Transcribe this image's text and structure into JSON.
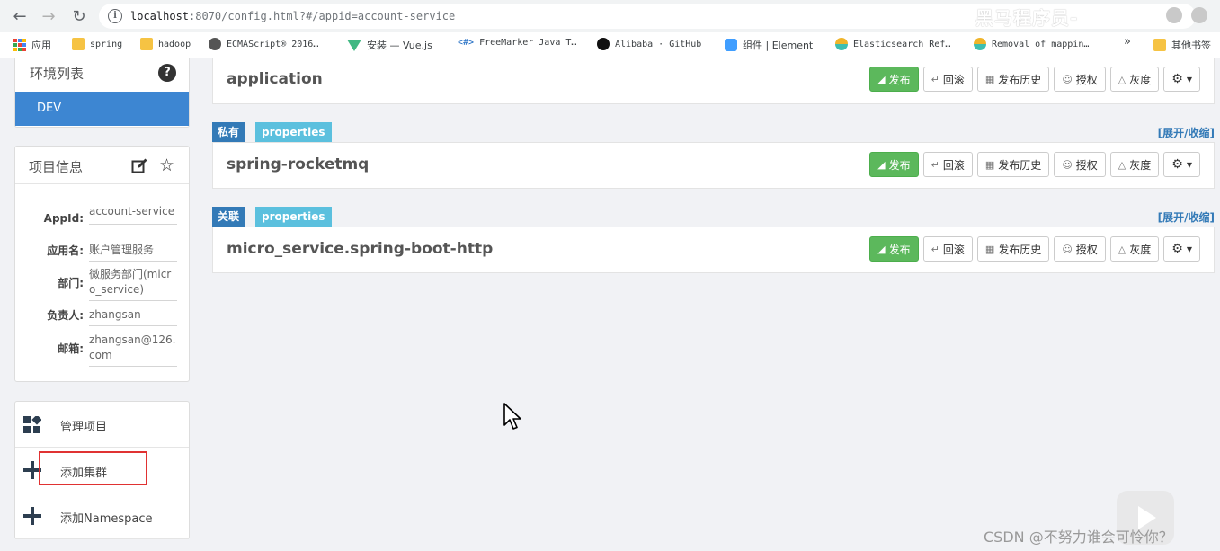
{
  "browser": {
    "url_host": "localhost",
    "url_rest": ":8070/config.html?#/appid=account-service",
    "watermark": "黑马程序员-",
    "bookmarks": [
      {
        "label": "应用",
        "icon": "apps-grid-icon"
      },
      {
        "label": "spring",
        "icon": "folder-icon"
      },
      {
        "label": "hadoop",
        "icon": "folder-icon"
      },
      {
        "label": "ECMAScript® 2016…",
        "icon": "globe-icon"
      },
      {
        "label": "安装 — Vue.js",
        "icon": "vue-icon"
      },
      {
        "label": "FreeMarker Java T…",
        "icon": "code-icon"
      },
      {
        "label": "Alibaba · GitHub",
        "icon": "github-icon"
      },
      {
        "label": "组件 | Element",
        "icon": "element-icon"
      },
      {
        "label": "Elasticsearch Ref…",
        "icon": "elastic-icon"
      },
      {
        "label": "Removal of mappin…",
        "icon": "elastic-icon"
      },
      {
        "label": "»",
        "icon": ""
      },
      {
        "label": "其他书签",
        "icon": "folder-icon"
      }
    ]
  },
  "sidebar": {
    "env_title": "环境列表",
    "env_item": "DEV",
    "info_title": "项目信息",
    "info": [
      {
        "label": "AppId:",
        "value": "account-service"
      },
      {
        "label": "应用名:",
        "value": "账户管理服务"
      },
      {
        "label": "部门:",
        "value": "微服务部门(micro_service)"
      },
      {
        "label": "负责人:",
        "value": "zhangsan"
      },
      {
        "label": "邮箱:",
        "value": "zhangsan@126.com"
      }
    ],
    "actions": [
      {
        "label": "管理项目"
      },
      {
        "label": "添加集群"
      },
      {
        "label": "添加Namespace"
      }
    ]
  },
  "buttons": {
    "publish": "发布",
    "rollback": "回滚",
    "history": "发布历史",
    "auth": "授权",
    "gray": "灰度"
  },
  "namespaces": [
    {
      "name": "application",
      "tag_scope": "",
      "tag_format": ""
    },
    {
      "name": "spring-rocketmq",
      "tag_scope": "私有",
      "tag_format": "properties"
    },
    {
      "name": "micro_service.spring-boot-http",
      "tag_scope": "关联",
      "tag_format": "properties"
    }
  ],
  "toggle_label": "[展开/收缩]",
  "watermark_bottom": "CSDN @不努力谁会可怜你？",
  "colors": {
    "primary_blue": "#3d86d2",
    "publish_green": "#5cb85c",
    "tag_blue": "#337ab7",
    "tag_cyan": "#5bc0de",
    "highlight_red": "#e03232"
  }
}
